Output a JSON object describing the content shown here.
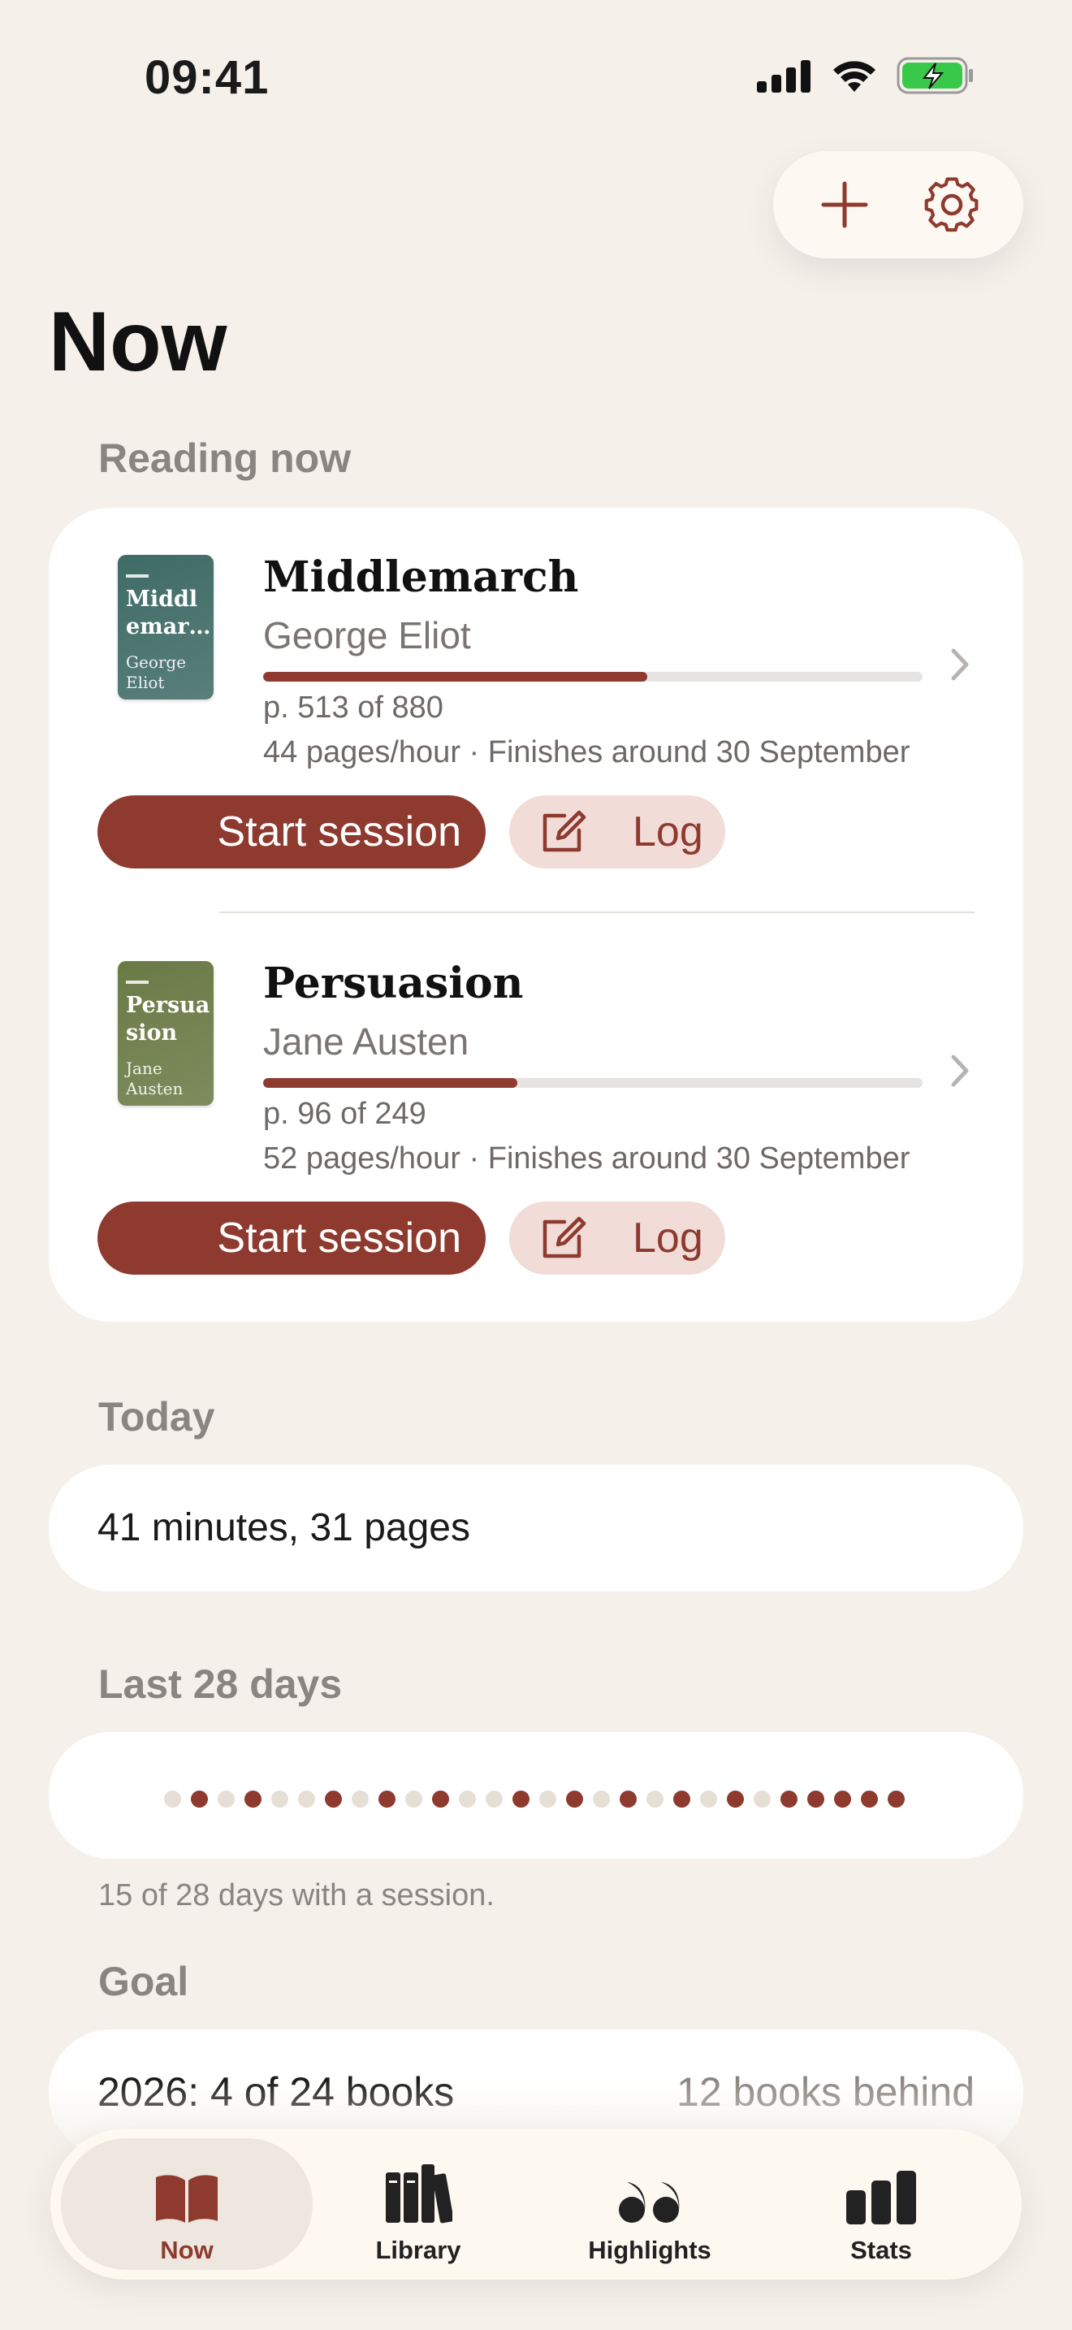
{
  "status_bar": {
    "time": "09:41"
  },
  "page": {
    "title": "Now"
  },
  "sections": {
    "reading_now": "Reading now",
    "today": "Today",
    "last_28_days": "Last 28 days",
    "goal": "Goal"
  },
  "books": [
    {
      "cover_title": "Middl emar…",
      "cover_author": "George Eliot",
      "cover_color": "#3f6b66",
      "title": "Middlemarch",
      "author": "George Eliot",
      "progress": 0.583,
      "pages": "p. 513 of 880",
      "pace": "44 pages/hour · Finishes around 30 September",
      "start_label": "Start session",
      "log_label": "Log"
    },
    {
      "cover_title": "Persua sion",
      "cover_author": "Jane Austen",
      "cover_color": "#6a7a45",
      "title": "Persuasion",
      "author": "Jane Austen",
      "progress": 0.386,
      "pages": "p. 96 of 249",
      "pace": "52 pages/hour · Finishes around 30 September",
      "start_label": "Start session",
      "log_label": "Log"
    }
  ],
  "today": {
    "summary": "41 minutes, 31 pages"
  },
  "last_28_days": {
    "days": [
      0,
      1,
      0,
      1,
      0,
      0,
      1,
      0,
      1,
      0,
      1,
      0,
      0,
      1,
      0,
      1,
      0,
      1,
      0,
      1,
      0,
      1,
      0,
      1,
      1,
      1,
      1,
      1
    ],
    "caption": "15 of 28 days with a session."
  },
  "goal": {
    "label": "2026: 4 of 24 books",
    "status": "12 books behind"
  },
  "tabs": [
    {
      "label": "Now",
      "icon": "open-book-icon",
      "active": true
    },
    {
      "label": "Library",
      "icon": "books-icon",
      "active": false
    },
    {
      "label": "Highlights",
      "icon": "quote-icon",
      "active": false
    },
    {
      "label": "Stats",
      "icon": "bar-chart-icon",
      "active": false
    }
  ],
  "colors": {
    "accent": "#8e3a2f",
    "background": "#f5f0ea",
    "card": "#ffffff"
  }
}
